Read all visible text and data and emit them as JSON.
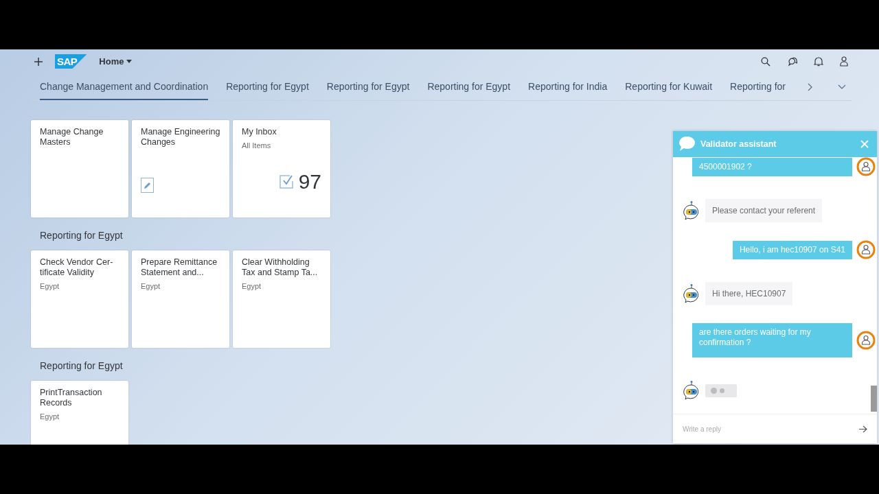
{
  "shell": {
    "logo": "SAP",
    "home": "Home"
  },
  "tabs": [
    {
      "label": "Change Management and Coordination",
      "selected": true
    },
    {
      "label": "Reporting for Egypt",
      "selected": false
    },
    {
      "label": "Reporting for Egypt",
      "selected": false
    },
    {
      "label": "Reporting for Egypt",
      "selected": false
    },
    {
      "label": "Reporting for India",
      "selected": false
    },
    {
      "label": "Reporting for Kuwait",
      "selected": false
    },
    {
      "label": "Reporting for",
      "selected": false
    }
  ],
  "groups": [
    {
      "tiles": [
        {
          "kind": "plain",
          "title": "Manage Change Masters"
        },
        {
          "kind": "icon",
          "title": "Manage Engineering Changes"
        },
        {
          "kind": "count",
          "title": "My Inbox",
          "subtitle": "All Items",
          "number": "97"
        }
      ]
    },
    {
      "title": "Reporting for Egypt",
      "tiles": [
        {
          "kind": "plain",
          "title": "Check Vendor Cer-tificate Validity",
          "subtitle": "Egypt"
        },
        {
          "kind": "plain",
          "title": "Prepare Remittance Statement and...",
          "subtitle": "Egypt"
        },
        {
          "kind": "plain",
          "title": "Clear Withholding Tax and Stamp Ta...",
          "subtitle": "Egypt"
        }
      ]
    },
    {
      "title": "Reporting for Egypt",
      "tiles": [
        {
          "kind": "plain",
          "title": "PrintTransaction Records",
          "subtitle": "Egypt"
        }
      ]
    }
  ],
  "chat": {
    "title": "Validator assistant",
    "messages": [
      {
        "kind": "user",
        "text": "4500001902 ?"
      },
      {
        "kind": "bot",
        "text": "Please contact your referent"
      },
      {
        "kind": "user",
        "text": "Hello, i am hec10907 on S41"
      },
      {
        "kind": "bot",
        "text": "Hi there, HEC10907"
      },
      {
        "kind": "user",
        "text": "are there orders waiting for my confirmation ?"
      },
      {
        "kind": "typing"
      }
    ],
    "input": {
      "placeholder": "Write a reply"
    }
  }
}
